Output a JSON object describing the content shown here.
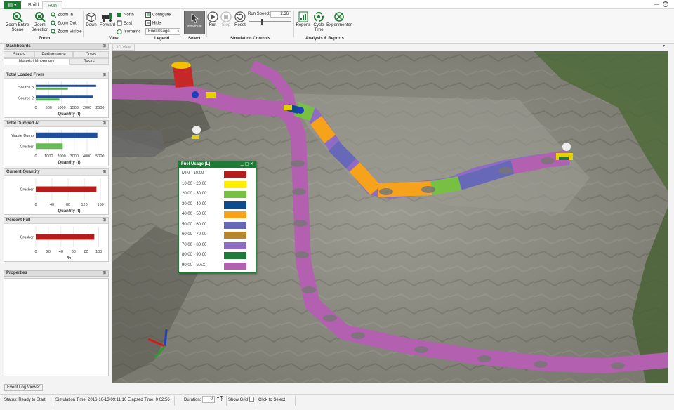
{
  "tabs": {
    "file": "▤ ▾",
    "build": "Build",
    "run": "Run"
  },
  "window": {
    "minimize": "—",
    "help": "?"
  },
  "ribbon": {
    "zoom": {
      "zoom_entire": "Zoom Entire\nScene",
      "zoom_selection": "Zoom\nSelection",
      "zoom_in": "Zoom In",
      "zoom_out": "Zoom Out",
      "zoom_visible": "Zoom Visible",
      "label": "Zoom"
    },
    "view": {
      "down": "Down",
      "forward": "Forward",
      "north": "North",
      "east": "East",
      "isometric": "Isometric",
      "label": "View"
    },
    "legend": {
      "configure": "Configure",
      "hide": "Hide",
      "selected": "Fuel Usage",
      "label": "Legend"
    },
    "select": {
      "individual": "Individual",
      "label": "Select"
    },
    "sim": {
      "run": "Run",
      "stop": "Stop",
      "reset": "Reset",
      "run_speed_label": "Run Speed:",
      "run_speed_value": "2.36",
      "label": "Simulation Controls"
    },
    "analysis": {
      "reports": "Reports",
      "cycle_time": "Cycle\nTime",
      "experimenter": "Experimenter",
      "label": "Analysis & Reports"
    }
  },
  "leftpane": {
    "dashboards_title": "Dashboards",
    "pin": "📌",
    "tabs_row1": [
      "States",
      "Performance",
      "Costs"
    ],
    "tabs_row2": [
      "Material Movement",
      "Tasks"
    ],
    "properties_title": "Properties"
  },
  "cards": [
    {
      "title": "Total Loaded From",
      "categories": [
        "Source 3",
        "Source 2"
      ],
      "series_colors": [
        "#1f4e9c",
        "#4caf50"
      ],
      "values": [
        [
          2350,
          2230
        ],
        [
          1250,
          920
        ]
      ],
      "ticks": [
        "0",
        "500",
        "1000",
        "1500",
        "2000",
        "2500"
      ],
      "xmax": 2600,
      "xlabel": "Quantity (t)"
    },
    {
      "title": "Total Dumped At",
      "categories": [
        "Waste Dump",
        "Crusher"
      ],
      "colors": [
        "#1f4e9c",
        "#66bb55"
      ],
      "values": [
        4800,
        2100
      ],
      "ticks": [
        "0",
        "1000",
        "2000",
        "3000",
        "4000",
        "5000"
      ],
      "xmax": 5200,
      "xlabel": "Quantity (t)"
    },
    {
      "title": "Current Quantity",
      "categories": [
        "Crusher"
      ],
      "colors": [
        "#b71c1c"
      ],
      "values": [
        150
      ],
      "ticks": [
        "0",
        "40",
        "80",
        "120",
        "160"
      ],
      "xmax": 165,
      "xlabel": "Quantity (t)"
    },
    {
      "title": "Percent Full",
      "categories": [
        "Crusher"
      ],
      "colors": [
        "#b71c1c"
      ],
      "values": [
        93
      ],
      "ticks": [
        "0",
        "20",
        "40",
        "60",
        "80",
        "100"
      ],
      "xmax": 106,
      "xlabel": "%"
    }
  ],
  "view_tab": "3D View",
  "view_menu": "▾",
  "legend_window": {
    "title": "Fuel Usage (L)",
    "controls": "▁ ▢ ✕",
    "items": [
      {
        "label": "MIN - 10.00",
        "color": "#b71c1c"
      },
      {
        "label": "10.00 - 20.00",
        "color": "#ffee00"
      },
      {
        "label": "20.00 - 30.00",
        "color": "#77c043"
      },
      {
        "label": "30.00 - 40.00",
        "color": "#0d4a8f"
      },
      {
        "label": "40.00 - 50.00",
        "color": "#f7a21b"
      },
      {
        "label": "50.00 - 60.00",
        "color": "#6868b8"
      },
      {
        "label": "60.00 - 70.00",
        "color": "#b8862a"
      },
      {
        "label": "70.00 - 80.00",
        "color": "#8e6cc4"
      },
      {
        "label": "80.00 - 90.00",
        "color": "#1f7a3c"
      },
      {
        "label": "90.00 - MAX",
        "color": "#b460b0"
      }
    ]
  },
  "event_log": "Event Log Viewer",
  "status": {
    "ready": "Status: Ready to Start",
    "sim_time": "Simulation Time: 2016-10-13 09:11:10",
    "elapsed": "Elapsed Time: 0 02:56",
    "duration_label": "Duration:",
    "duration_value": "0",
    "duration_unit": "h",
    "show_grid": "Show Grid",
    "click_select": "Click to Select"
  }
}
